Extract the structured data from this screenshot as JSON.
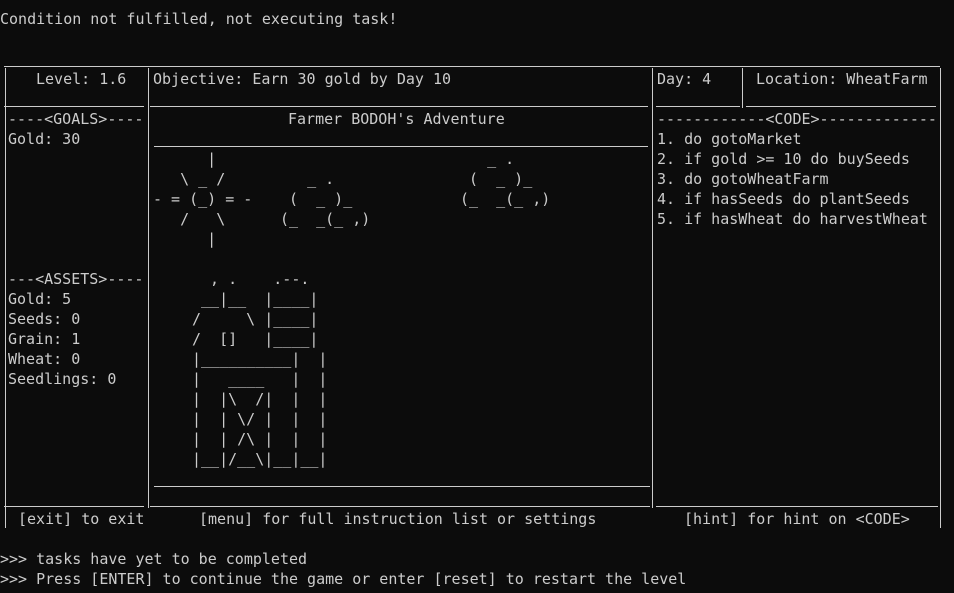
{
  "status_message": "Condition not fulfilled, not executing task!",
  "header": {
    "level": "Level: 1.6",
    "objective": "Objective: Earn 30 gold by Day 10",
    "day": "Day: 4",
    "location": "Location: WheatFarm"
  },
  "goals": {
    "title": "----<GOALS>----",
    "items": [
      "Gold: 30"
    ]
  },
  "assets": {
    "title": "---<ASSETS>----",
    "items": [
      "Gold: 5",
      "Seeds: 0",
      "Grain: 1",
      "Wheat: 0",
      "Seedlings: 0"
    ]
  },
  "game": {
    "title": "Farmer BODOH's Adventure"
  },
  "code": {
    "title": "------------<CODE>-------------",
    "lines": [
      "1. do gotoMarket",
      "2. if gold >= 10 do buySeeds",
      "3. do gotoWheatFarm",
      "4. if hasSeeds do plantSeeds",
      "5. if hasWheat do harvestWheat"
    ]
  },
  "footer": {
    "exit": "[exit] to exit",
    "menu": "[menu] for full instruction list or settings",
    "hint": "[hint] for hint on <CODE>"
  },
  "prompts": [
    ">>> tasks have yet to be completed",
    ">>> Press [ENTER] to continue the game or enter [reset] to restart the level"
  ],
  "ascii_art": {
    "sun": "      |\n   \\ _ /\n- = (_) = -\n   /   \\\n      |",
    "cloud_left": "   _ .\n (  _ )_\n(_  _(_ ,)",
    "cloud_right": "   _ .\n (  _ )_\n(_  _(_ ,)",
    "barn": "  , .    .--.\n __|__  |____|\n/     \\ |____|\n/  []   |____|\n|__________|  |\n|   ____   |  |\n|  |\\  /|  |  |\n|  | \\/ |  |  |\n|  | /\\ |  |  |\n|__|/__\\|__|__|"
  },
  "colors": {
    "background": "#0c0c0c",
    "foreground": "#cccccc"
  }
}
